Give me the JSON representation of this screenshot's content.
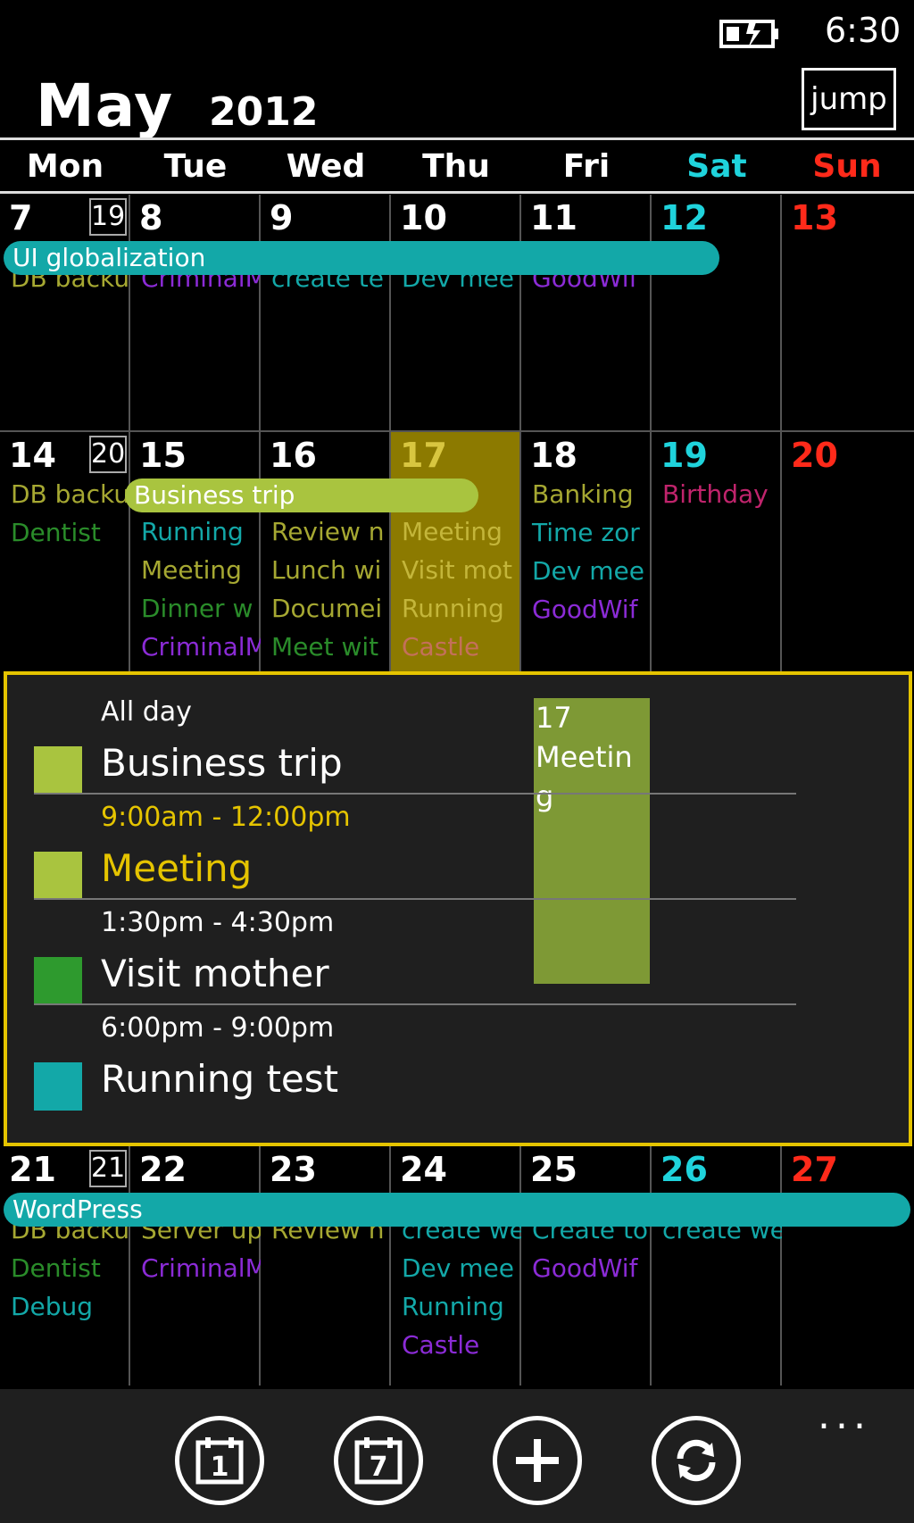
{
  "status": {
    "time": "6:30",
    "battery_icon": "battery-charging-icon"
  },
  "header": {
    "month": "May",
    "year": "2012",
    "jump_label": "jump"
  },
  "colors": {
    "sat": "#1fd3dc",
    "sun": "#ff2a1a",
    "olive": "#a6a832",
    "purple": "#8b2bd6",
    "teal": "#13a8a8",
    "green": "#2a8c2a",
    "magenta": "#c0246c",
    "bar_teal": "#13a8a8",
    "bar_lime": "#a9c43f",
    "today": "#8c7a00",
    "accent": "#e5c400"
  },
  "weekdays": [
    "Mon",
    "Tue",
    "Wed",
    "Thu",
    "Fri",
    "Sat",
    "Sun"
  ],
  "weeks": [
    {
      "week_number": "19",
      "days": [
        "7",
        "8",
        "9",
        "10",
        "11",
        "12",
        "13"
      ],
      "bar": {
        "label": "UI globalization"
      },
      "events": [
        [
          {
            "t": "DB backu",
            "c": "olive"
          }
        ],
        [
          {
            "t": "CriminalM",
            "c": "purple"
          }
        ],
        [
          {
            "t": "create te",
            "c": "teal"
          }
        ],
        [
          {
            "t": "Dev mee",
            "c": "teal"
          }
        ],
        [
          {
            "t": "GoodWif",
            "c": "purple"
          }
        ],
        [],
        []
      ]
    },
    {
      "week_number": "20",
      "days": [
        "14",
        "15",
        "16",
        "17",
        "18",
        "19",
        "20"
      ],
      "bar": {
        "label": "Business trip"
      },
      "events": [
        [
          {
            "t": "DB backu",
            "c": "olive"
          },
          {
            "t": "Dentist",
            "c": "green"
          }
        ],
        [
          {
            "t": "Running",
            "c": "teal"
          },
          {
            "t": "Meeting",
            "c": "olive"
          },
          {
            "t": "Dinner w",
            "c": "green"
          },
          {
            "t": "CriminalM",
            "c": "purple"
          }
        ],
        [
          {
            "t": "Review n",
            "c": "olive"
          },
          {
            "t": "Lunch wi",
            "c": "olive"
          },
          {
            "t": "Documei",
            "c": "olive"
          },
          {
            "t": "Meet wit",
            "c": "green"
          }
        ],
        [
          {
            "t": "Meeting",
            "c": "olive"
          },
          {
            "t": "Visit mot",
            "c": "olive"
          },
          {
            "t": "Running",
            "c": "olive"
          },
          {
            "t": "Castle",
            "c": "magenta"
          }
        ],
        [
          {
            "t": "Banking",
            "c": "olive"
          },
          {
            "t": "Time zor",
            "c": "teal"
          },
          {
            "t": "Dev mee",
            "c": "teal"
          },
          {
            "t": "GoodWif",
            "c": "purple"
          }
        ],
        [
          {
            "t": "Birthday",
            "c": "magenta"
          }
        ],
        []
      ]
    },
    {
      "week_number": "21",
      "days": [
        "21",
        "22",
        "23",
        "24",
        "25",
        "26",
        "27"
      ],
      "bar": {
        "label": "WordPress"
      },
      "events": [
        [
          {
            "t": "DB backu",
            "c": "olive"
          },
          {
            "t": "Dentist",
            "c": "green"
          },
          {
            "t": "Debug",
            "c": "teal"
          }
        ],
        [
          {
            "t": "Server up",
            "c": "olive"
          },
          {
            "t": "CriminalM",
            "c": "purple"
          }
        ],
        [
          {
            "t": "Review n",
            "c": "olive"
          }
        ],
        [
          {
            "t": "create we",
            "c": "teal"
          },
          {
            "t": "Dev mee",
            "c": "teal"
          },
          {
            "t": "Running",
            "c": "teal"
          },
          {
            "t": "Castle",
            "c": "purple"
          }
        ],
        [
          {
            "t": "Create to",
            "c": "teal"
          },
          {
            "t": "GoodWif",
            "c": "purple"
          }
        ],
        [
          {
            "t": "create we",
            "c": "teal"
          }
        ],
        []
      ]
    }
  ],
  "detail": {
    "items": [
      {
        "time": "All day",
        "title": "Business trip",
        "color": "#a9c43f",
        "title_color": "#ffffff",
        "time_color": "#ffffff"
      },
      {
        "time": "9:00am - 12:00pm",
        "title": "Meeting",
        "color": "#a9c43f",
        "title_color": "#e5c400",
        "time_color": "#e5c400"
      },
      {
        "time": "1:30pm - 4:30pm",
        "title": "Visit mother",
        "color": "#2e9a2e",
        "title_color": "#ffffff",
        "time_color": "#ffffff"
      },
      {
        "time": "6:00pm - 9:00pm",
        "title": "Running test",
        "color": "#13a8a8",
        "title_color": "#ffffff",
        "time_color": "#ffffff"
      }
    ],
    "block": {
      "day": "17",
      "line1": "Meetin",
      "line2": "g"
    }
  },
  "appbar": {
    "buttons": [
      {
        "name": "day-view-button",
        "icon": "calendar-day-icon",
        "glyph": "1"
      },
      {
        "name": "week-view-button",
        "icon": "calendar-week-icon",
        "glyph": "7"
      },
      {
        "name": "add-button",
        "icon": "plus-icon",
        "glyph": "+"
      },
      {
        "name": "sync-button",
        "icon": "sync-icon",
        "glyph": "⟳"
      }
    ],
    "more": "..."
  }
}
